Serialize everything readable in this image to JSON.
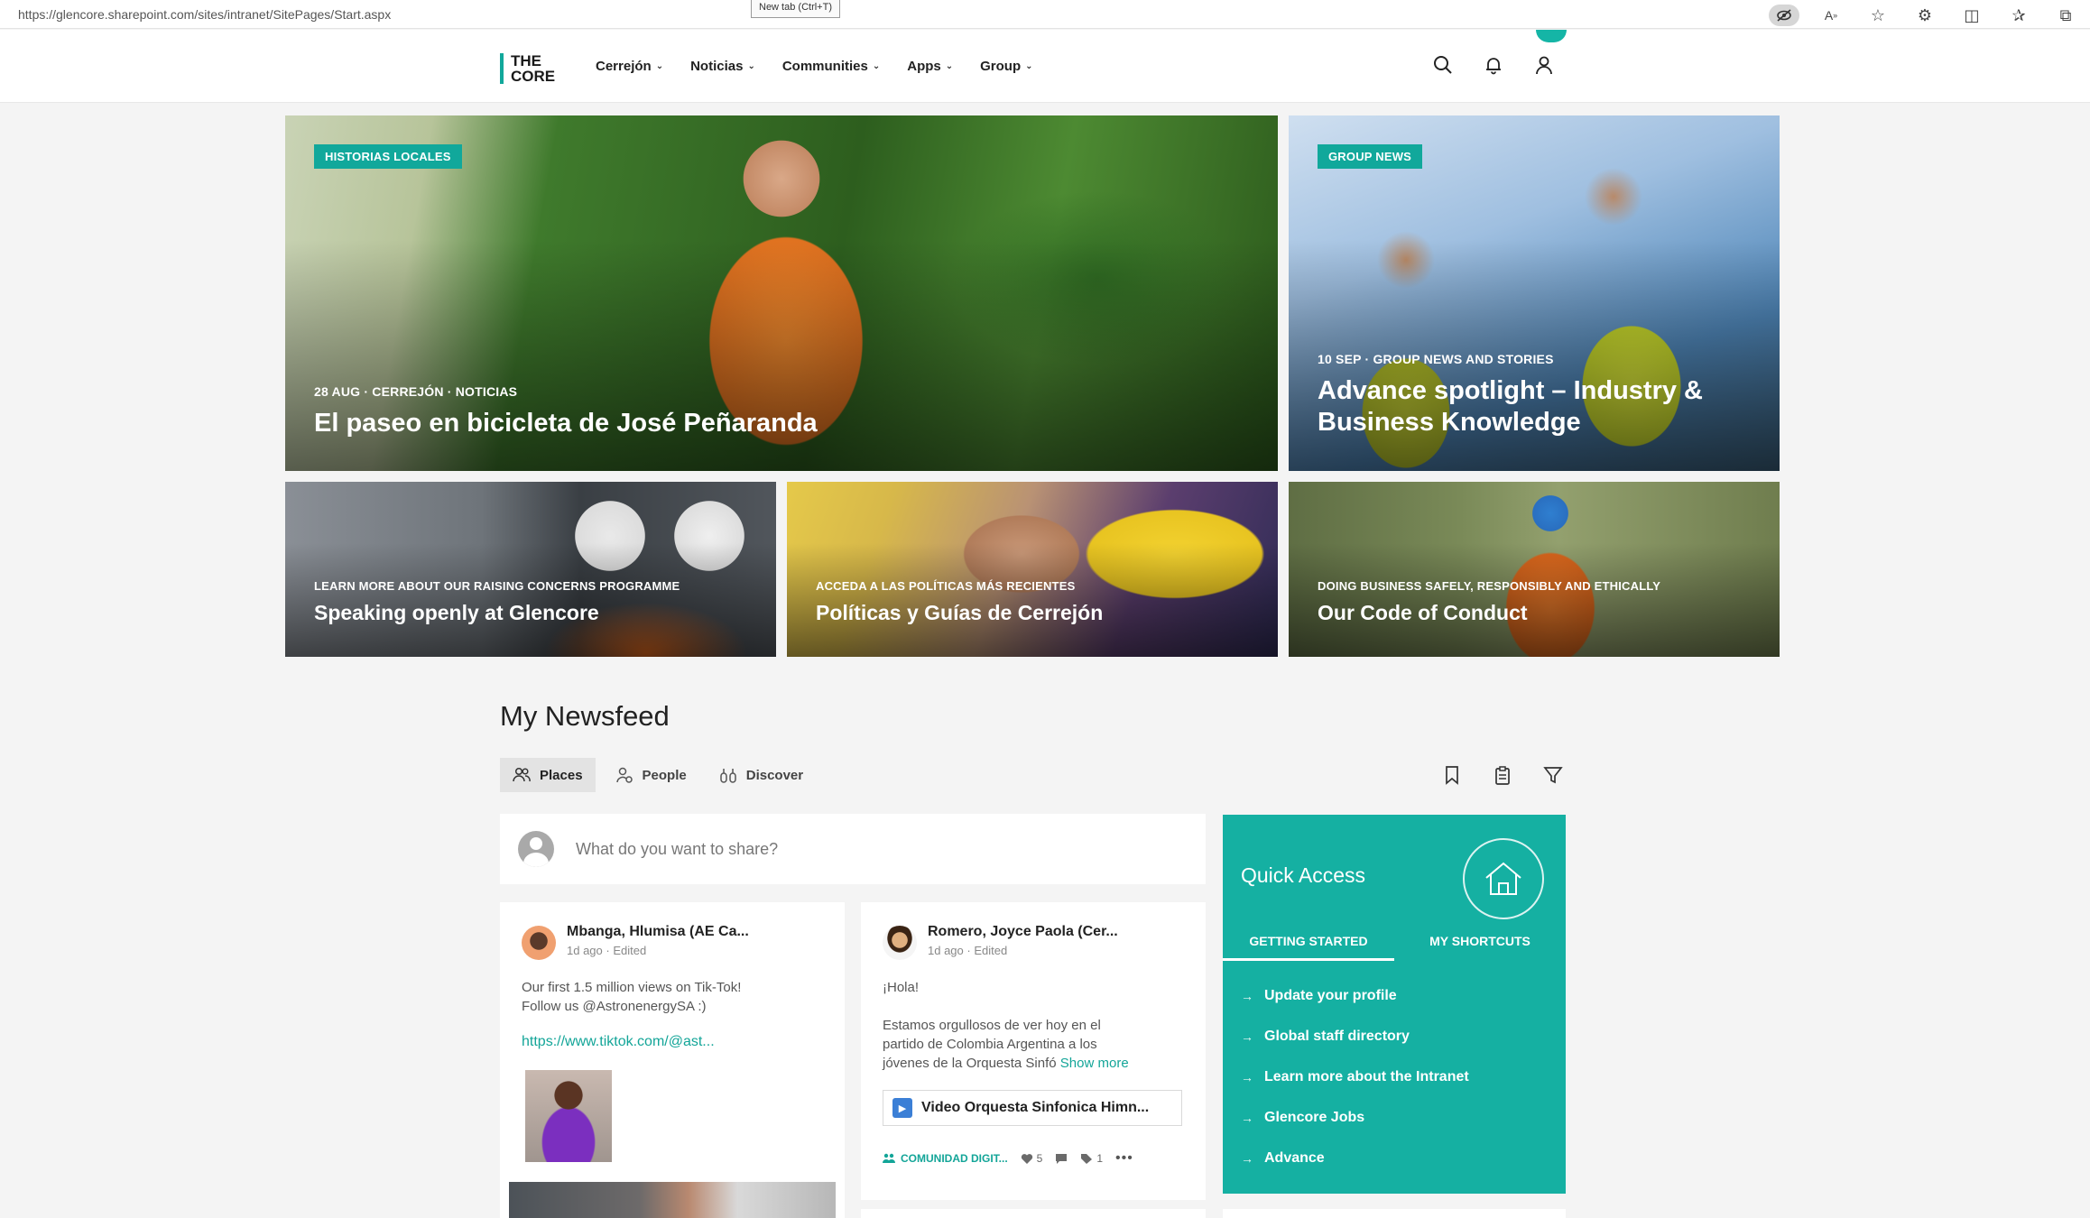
{
  "browser": {
    "url": "https://glencore.sharepoint.com/sites/intranet/SitePages/Start.aspx",
    "tooltip": "New tab (Ctrl+T)"
  },
  "header": {
    "logo_line1": "THE",
    "logo_line2": "CORE",
    "nav": [
      {
        "label": "Cerrejón"
      },
      {
        "label": "Noticias"
      },
      {
        "label": "Communities"
      },
      {
        "label": "Apps"
      },
      {
        "label": "Group"
      }
    ],
    "accent_color": "#11a89b"
  },
  "hero": [
    {
      "badge": "HISTORIAS LOCALES",
      "meta": "28 AUG · CERREJÓN · NOTICIAS",
      "title": "El paseo en bicicleta de José Peñaranda"
    },
    {
      "badge": "GROUP NEWS",
      "meta": "10 SEP · GROUP NEWS AND STORIES",
      "title": "Advance spotlight – Industry & Business Knowledge"
    },
    {
      "meta": "LEARN MORE ABOUT OUR RAISING CONCERNS PROGRAMME",
      "title": "Speaking openly at Glencore"
    },
    {
      "meta": "ACCEDA A LAS POLÍTICAS MÁS RECIENTES",
      "title": "Políticas y Guías de Cerrejón"
    },
    {
      "meta": "DOING BUSINESS SAFELY, RESPONSIBLY AND ETHICALLY",
      "title": "Our Code of Conduct"
    }
  ],
  "newsfeed": {
    "title": "My Newsfeed",
    "tabs": [
      {
        "label": "Places",
        "icon": "people-icon"
      },
      {
        "label": "People",
        "icon": "person-follow-icon"
      },
      {
        "label": "Discover",
        "icon": "binoculars-icon"
      }
    ],
    "share_placeholder": "What do you want to share?",
    "posts": [
      {
        "author": "Mbanga, Hlumisa (AE Ca...",
        "time": "1d ago · Edited",
        "text_line1": "Our first 1.5 million views on Tik-Tok!",
        "text_line2": "Follow us @AstronenergySA :)",
        "link": "https://www.tiktok.com/@ast..."
      },
      {
        "author": "Romero, Joyce Paola (Cer...",
        "time": "1d ago · Edited",
        "greeting": "¡Hola!",
        "text_line1": "Estamos orgullosos de ver hoy en el",
        "text_line2": "partido de Colombia Argentina a los",
        "text_line3": "jóvenes de la Orquesta Sinfó",
        "show_more": "Show more",
        "attachment": "Video Orquesta Sinfonica Himn...",
        "community": "COMUNIDAD DIGIT...",
        "likes": "5",
        "tags": "1"
      }
    ]
  },
  "quick_access": {
    "title": "Quick Access",
    "tabs": [
      "GETTING STARTED",
      "MY SHORTCUTS"
    ],
    "links": [
      "Update your profile",
      "Global staff directory",
      "Learn more about the Intranet",
      "Glencore Jobs",
      "Advance"
    ],
    "color": "#15b0a2"
  }
}
